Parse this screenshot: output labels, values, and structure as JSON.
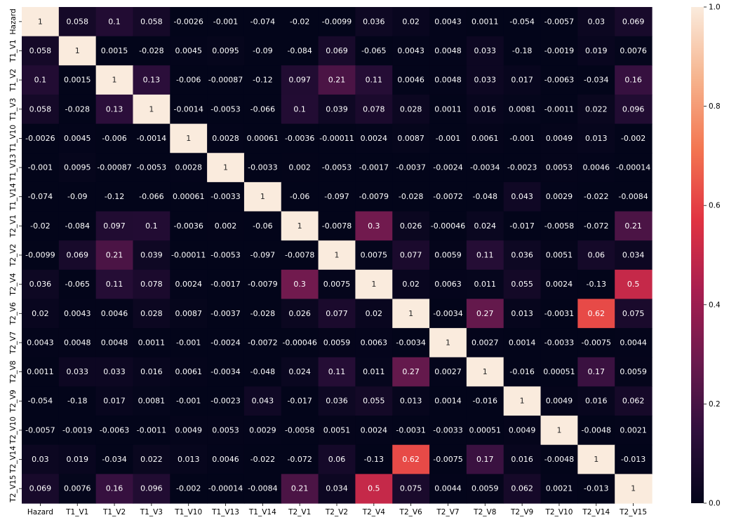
{
  "chart_data": {
    "type": "heatmap",
    "title": "",
    "xlabel": "",
    "ylabel": "",
    "labels": [
      "Hazard",
      "T1_V1",
      "T1_V2",
      "T1_V3",
      "T1_V10",
      "T1_V13",
      "T1_V14",
      "T2_V1",
      "T2_V2",
      "T2_V4",
      "T2_V6",
      "T2_V7",
      "T2_V8",
      "T2_V9",
      "T2_V10",
      "T2_V14",
      "T2_V15"
    ],
    "matrix": [
      [
        "1",
        "0.058",
        "0.1",
        "0.058",
        "-0.0026",
        "-0.001",
        "-0.074",
        "-0.02",
        "-0.0099",
        "0.036",
        "0.02",
        "0.0043",
        "0.0011",
        "-0.054",
        "-0.0057",
        "0.03",
        "0.069"
      ],
      [
        "0.058",
        "1",
        "0.0015",
        "-0.028",
        "0.0045",
        "0.0095",
        "-0.09",
        "-0.084",
        "0.069",
        "-0.065",
        "0.0043",
        "0.0048",
        "0.033",
        "-0.18",
        "-0.0019",
        "0.019",
        "0.0076"
      ],
      [
        "0.1",
        "0.0015",
        "1",
        "0.13",
        "-0.006",
        "-0.00087",
        "-0.12",
        "0.097",
        "0.21",
        "0.11",
        "0.0046",
        "0.0048",
        "0.033",
        "0.017",
        "-0.0063",
        "-0.034",
        "0.16"
      ],
      [
        "0.058",
        "-0.028",
        "0.13",
        "1",
        "-0.0014",
        "-0.0053",
        "-0.066",
        "0.1",
        "0.039",
        "0.078",
        "0.028",
        "0.0011",
        "0.016",
        "0.0081",
        "-0.0011",
        "0.022",
        "0.096"
      ],
      [
        "-0.0026",
        "0.0045",
        "-0.006",
        "-0.0014",
        "1",
        "0.0028",
        "0.00061",
        "-0.0036",
        "-0.00011",
        "0.0024",
        "0.0087",
        "-0.001",
        "0.0061",
        "-0.001",
        "0.0049",
        "0.013",
        "-0.002"
      ],
      [
        "-0.001",
        "0.0095",
        "-0.00087",
        "-0.0053",
        "0.0028",
        "1",
        "-0.0033",
        "0.002",
        "-0.0053",
        "-0.0017",
        "-0.0037",
        "-0.0024",
        "-0.0034",
        "-0.0023",
        "0.0053",
        "0.0046",
        "-0.00014"
      ],
      [
        "-0.074",
        "-0.09",
        "-0.12",
        "-0.066",
        "0.00061",
        "-0.0033",
        "1",
        "-0.06",
        "-0.097",
        "-0.0079",
        "-0.028",
        "-0.0072",
        "-0.048",
        "0.043",
        "0.0029",
        "-0.022",
        "-0.0084"
      ],
      [
        "-0.02",
        "-0.084",
        "0.097",
        "0.1",
        "-0.0036",
        "0.002",
        "-0.06",
        "1",
        "-0.0078",
        "0.3",
        "0.026",
        "-0.00046",
        "0.024",
        "-0.017",
        "-0.0058",
        "-0.072",
        "0.21"
      ],
      [
        "-0.0099",
        "0.069",
        "0.21",
        "0.039",
        "-0.00011",
        "-0.0053",
        "-0.097",
        "-0.0078",
        "1",
        "0.0075",
        "0.077",
        "0.0059",
        "0.11",
        "0.036",
        "0.0051",
        "0.06",
        "0.034"
      ],
      [
        "0.036",
        "-0.065",
        "0.11",
        "0.078",
        "0.0024",
        "-0.0017",
        "-0.0079",
        "0.3",
        "0.0075",
        "1",
        "0.02",
        "0.0063",
        "0.011",
        "0.055",
        "0.0024",
        "-0.13",
        "0.5"
      ],
      [
        "0.02",
        "0.0043",
        "0.0046",
        "0.028",
        "0.0087",
        "-0.0037",
        "-0.028",
        "0.026",
        "0.077",
        "0.02",
        "1",
        "-0.0034",
        "0.27",
        "0.013",
        "-0.0031",
        "0.62",
        "0.075"
      ],
      [
        "0.0043",
        "0.0048",
        "0.0048",
        "0.0011",
        "-0.001",
        "-0.0024",
        "-0.0072",
        "-0.00046",
        "0.0059",
        "0.0063",
        "-0.0034",
        "1",
        "0.0027",
        "0.0014",
        "-0.0033",
        "-0.0075",
        "0.0044"
      ],
      [
        "0.0011",
        "0.033",
        "0.033",
        "0.016",
        "0.0061",
        "-0.0034",
        "-0.048",
        "0.024",
        "0.11",
        "0.011",
        "0.27",
        "0.0027",
        "1",
        "-0.016",
        "0.00051",
        "0.17",
        "0.0059"
      ],
      [
        "-0.054",
        "-0.18",
        "0.017",
        "0.0081",
        "-0.001",
        "-0.0023",
        "0.043",
        "-0.017",
        "0.036",
        "0.055",
        "0.013",
        "0.0014",
        "-0.016",
        "1",
        "0.0049",
        "0.016",
        "0.062"
      ],
      [
        "-0.0057",
        "-0.0019",
        "-0.0063",
        "-0.0011",
        "0.0049",
        "0.0053",
        "0.0029",
        "-0.0058",
        "0.0051",
        "0.0024",
        "-0.0031",
        "-0.0033",
        "0.00051",
        "0.0049",
        "1",
        "-0.0048",
        "0.0021"
      ],
      [
        "0.03",
        "0.019",
        "-0.034",
        "0.022",
        "0.013",
        "0.0046",
        "-0.022",
        "-0.072",
        "0.06",
        "-0.13",
        "0.62",
        "-0.0075",
        "0.17",
        "0.016",
        "-0.0048",
        "1",
        "-0.013"
      ],
      [
        "0.069",
        "0.0076",
        "0.16",
        "0.096",
        "-0.002",
        "-0.00014",
        "-0.0084",
        "0.21",
        "0.034",
        "0.5",
        "0.075",
        "0.0044",
        "0.0059",
        "0.062",
        "0.0021",
        "-0.013",
        "1"
      ]
    ],
    "colorbar": {
      "range": [
        0.0,
        1.0
      ],
      "ticks": [
        "0.0",
        "0.2",
        "0.4",
        "0.6",
        "0.8",
        "1.0"
      ],
      "colormap": "rocket",
      "stops": [
        "#03051a",
        "#2f0f3d",
        "#6b1a4e",
        "#a81e50",
        "#e13342",
        "#f37651",
        "#f6b48e",
        "#faebdd"
      ]
    },
    "grid": false,
    "annotations": true
  }
}
